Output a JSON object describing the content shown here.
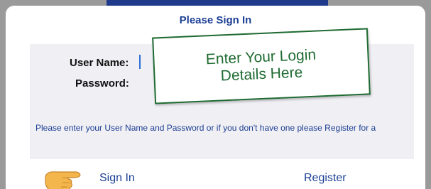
{
  "dialog": {
    "title": "Please Sign In"
  },
  "form": {
    "username_label": "User Name:",
    "password_label": "Password:",
    "help_text": "Please enter your User Name and Password or if you don't have one please Register for a"
  },
  "callout": {
    "text": "Enter Your Login Details Here"
  },
  "actions": {
    "signin_label": "Sign In",
    "register_label": "Register"
  },
  "icons": {
    "pointer": "pointing-hand-icon"
  },
  "colors": {
    "accent": "#1c3f94",
    "callout": "#1f6b32",
    "panel": "#f0eff4"
  }
}
